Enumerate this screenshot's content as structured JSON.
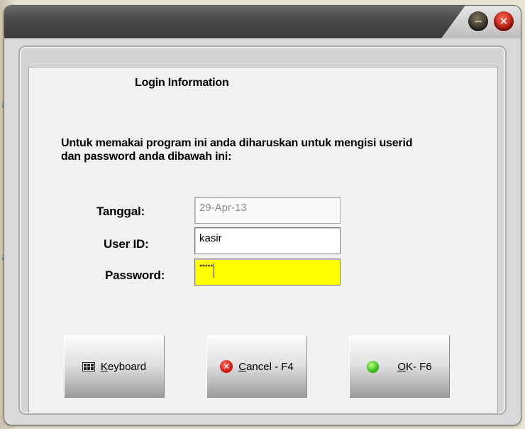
{
  "window": {
    "minimize_glyph": "−",
    "close_glyph": "✕"
  },
  "login": {
    "heading": "Login Information",
    "instruction_line1": "Untuk memakai program ini anda diharuskan untuk mengisi userid",
    "instruction_line2": "dan password anda dibawah ini:",
    "tanggal_label": "Tanggal:",
    "tanggal_value": "29-Apr-13",
    "userid_label": "User ID:",
    "userid_value": "kasir",
    "password_label": "Password:",
    "password_value": "*****"
  },
  "buttons": {
    "keyboard_hotkey": "K",
    "keyboard_rest": "eyboard",
    "cancel_hotkey": "C",
    "cancel_rest": "ancel - F4",
    "ok_hotkey": "O",
    "ok_rest": "K- F6"
  },
  "colors": {
    "active_field": "#ffff00",
    "close_button": "#c8100a",
    "ok_indicator": "#23b00a"
  },
  "icons": [
    "keyboard-icon",
    "cancel-icon",
    "ok-indicator-icon",
    "minimize-icon",
    "close-icon"
  ]
}
